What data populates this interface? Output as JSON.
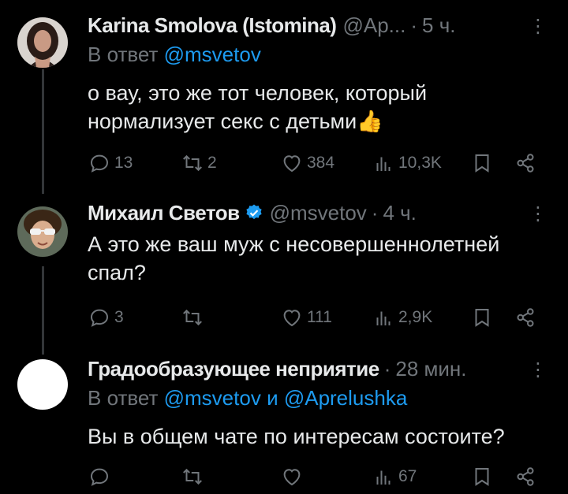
{
  "tweets": [
    {
      "name": "Karina Smolova (Istomina)",
      "handle": "@Ap...",
      "time": "5 ч.",
      "reply_prefix": "В ответ",
      "reply_mentions": "@msvetov",
      "reply_joiner": "",
      "reply_mention2": "",
      "text": "о вау, это же тот человек, который нормализует секс с детьми👍",
      "replies": "13",
      "retweets": "2",
      "likes": "384",
      "views": "10,3K",
      "verified": false
    },
    {
      "name": "Михаил Светов",
      "handle": "@msvetov",
      "time": "4 ч.",
      "reply_prefix": "",
      "reply_mentions": "",
      "text": "А это же ваш муж с несовершеннолетней спал?",
      "replies": "3",
      "retweets": "",
      "likes": "111",
      "views": "2,9K",
      "verified": true
    },
    {
      "name": "Градообразующее неприятие",
      "handle": "",
      "time": "28 мин.",
      "reply_prefix": "В ответ",
      "reply_mentions": "@msvetov",
      "reply_joiner": "и",
      "reply_mention2": "@Aprelushka",
      "text": "Вы в общем чате по интересам состоите?",
      "replies": "",
      "retweets": "",
      "likes": "",
      "views": "67",
      "verified": false
    }
  ],
  "colors": {
    "accent": "#1d9bf0",
    "muted": "#71767b",
    "text": "#e7e9ea",
    "bg": "#000000"
  }
}
